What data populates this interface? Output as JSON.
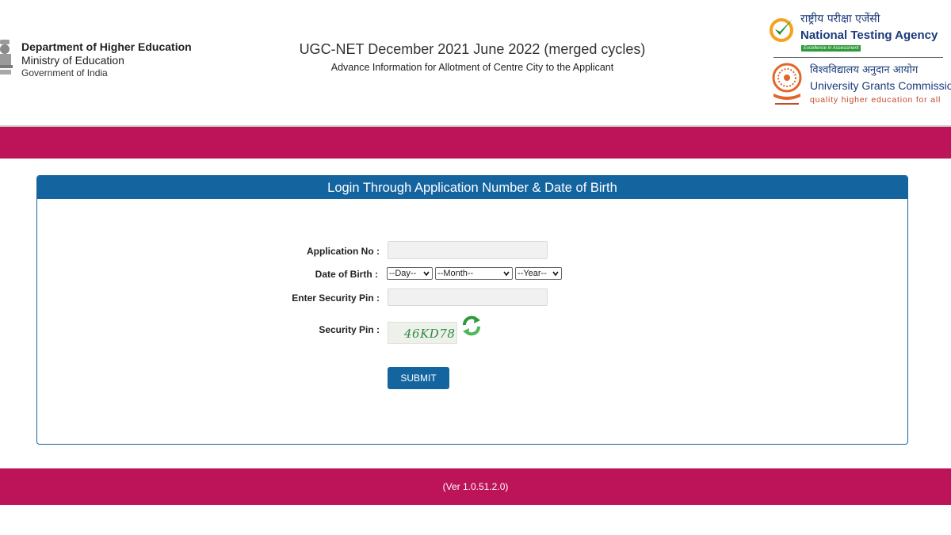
{
  "header": {
    "dept_line1": "Department of Higher Education",
    "dept_line2": "Ministry of Education",
    "dept_line3": "Government of India",
    "main_title": "UGC-NET December 2021 June 2022 (merged cycles)",
    "sub_title": "Advance Information for Allotment of Centre City to the Applicant",
    "nta_hindi": "राष्ट्रीय परीक्षा एजेंसी",
    "nta_name": "National Testing Agency",
    "nta_tagline": "Excellence in Assessment",
    "ugc_hindi": "विश्वविद्यालय अनुदान आयोग",
    "ugc_name": "University Grants Commission",
    "ugc_tagline": "quality higher education for all"
  },
  "login": {
    "title": "Login Through Application Number & Date of Birth",
    "application_no_label": "Application No :",
    "application_no_value": "",
    "dob_label": "Date of Birth :",
    "day_selected": "--Day--",
    "month_selected": "--Month--",
    "year_selected": "--Year--",
    "security_pin_input_label": "Enter Security Pin :",
    "security_pin_value": "",
    "security_pin_label": "Security Pin :",
    "captcha_text": "46KD78",
    "submit_label": "SUBMIT"
  },
  "footer": {
    "version": "(Ver 1.0.51.2.0)"
  },
  "colors": {
    "band": "#bd1358",
    "accent": "#1464a0"
  },
  "icons": {
    "refresh": "refresh-icon",
    "emblem": "emblem-icon"
  }
}
